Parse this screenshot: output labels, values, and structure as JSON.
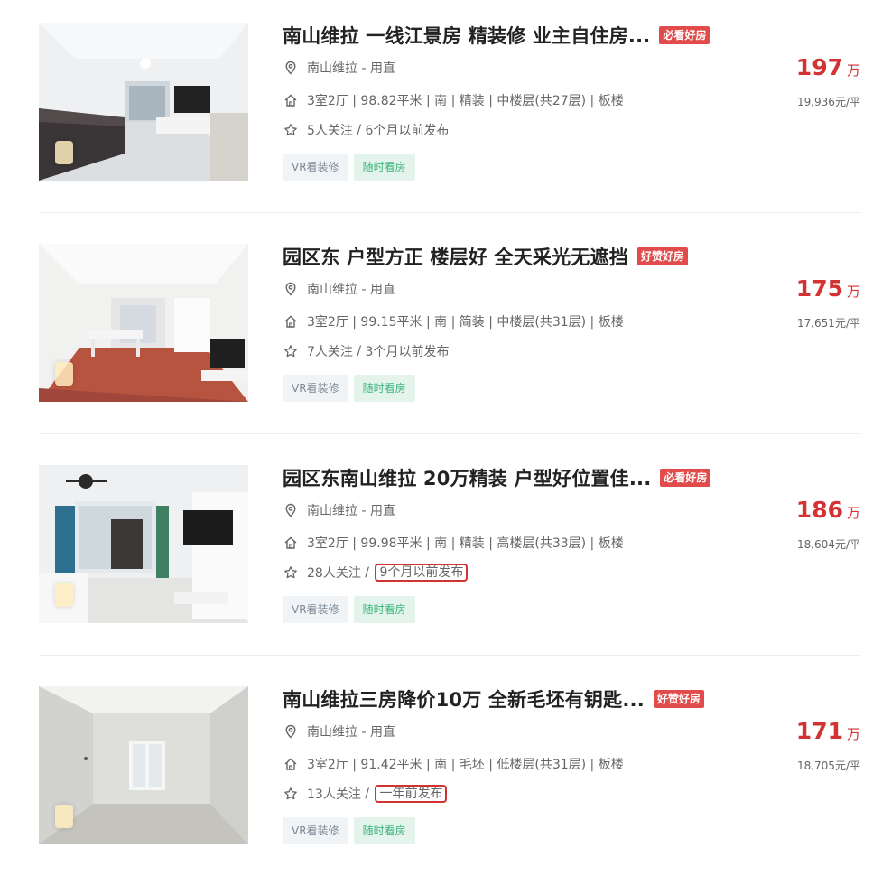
{
  "listings": [
    {
      "title": "南山维拉 一线江景房 精装修 业主自住房...",
      "tag": "必看好房",
      "location": "南山维拉 - 用直",
      "specs": "3室2厅 | 98.82平米 | 南 | 精装 | 中楼层(共27层) | 板楼",
      "follow_count": "5人关注",
      "separator": " / ",
      "published": "6个月以前发布",
      "published_highlighted": false,
      "chips": [
        "VR看装修",
        "随时看房"
      ],
      "price": "197",
      "price_unit": "万",
      "unit_price": "19,936元/平",
      "photo": "modern-living-room-dark-sofa"
    },
    {
      "title": "园区东 户型方正 楼层好 全天采光无遮挡",
      "tag": "好赞好房",
      "location": "南山维拉 - 用直",
      "specs": "3室2厅 | 99.15平米 | 南 | 简装 | 中楼层(共31层) | 板楼",
      "follow_count": "7人关注",
      "separator": " / ",
      "published": "3个月以前发布",
      "published_highlighted": false,
      "chips": [
        "VR看装修",
        "随时看房"
      ],
      "price": "175",
      "price_unit": "万",
      "unit_price": "17,651元/平",
      "photo": "bright-room-wood-floor"
    },
    {
      "title": "园区东南山维拉 20万精装 户型好位置佳...",
      "tag": "必看好房",
      "location": "南山维拉 - 用直",
      "specs": "3室2厅 | 99.98平米 | 南 | 精装 | 高楼层(共33层) | 板楼",
      "follow_count": "28人关注",
      "separator": " / ",
      "published": "9个月以前发布",
      "published_highlighted": true,
      "chips": [
        "VR看装修",
        "随时看房"
      ],
      "price": "186",
      "price_unit": "万",
      "unit_price": "18,604元/平",
      "photo": "white-living-room-tv-wall"
    },
    {
      "title": "南山维拉三房降价10万 全新毛坯有钥匙...",
      "tag": "好赞好房",
      "location": "南山维拉 - 用直",
      "specs": "3室2厅 | 91.42平米 | 南 | 毛坯 | 低楼层(共31层) | 板楼",
      "follow_count": "13人关注",
      "separator": " / ",
      "published": "一年前发布",
      "published_highlighted": true,
      "chips": [
        "VR看装修",
        "随时看房"
      ],
      "price": "171",
      "price_unit": "万",
      "unit_price": "18,705元/平",
      "photo": "empty-unfinished-room"
    }
  ],
  "colors": {
    "accent_red": "#d23232",
    "tag_red": "#e24b4b",
    "chip_green": "#3bb37c",
    "chip_gray": "#7a8793"
  },
  "icons": [
    "location-pin-icon",
    "house-icon",
    "star-icon",
    "vr-icon"
  ]
}
